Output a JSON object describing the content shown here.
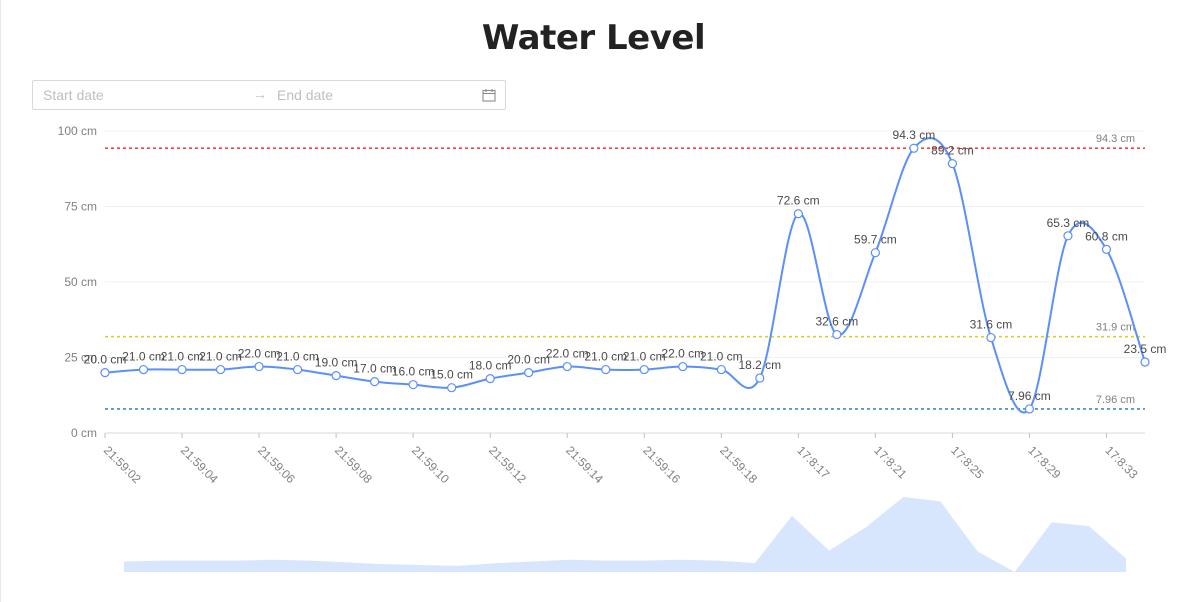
{
  "title": "Water Level",
  "range_picker": {
    "start_placeholder": "Start date",
    "end_placeholder": "End date",
    "separator": "→",
    "icon": "calendar-icon"
  },
  "colors": {
    "line": "#5b8ff9",
    "brush_fill": "#d8e6fd",
    "threshold_high": "#f04040",
    "threshold_mid": "#d4d426",
    "threshold_low": "#3a8ec6"
  },
  "chart_data": {
    "type": "line",
    "title": "Water Level",
    "unit": "cm",
    "ylim": [
      0,
      100
    ],
    "y_ticks": [
      "0 cm",
      "25 cm",
      "50 cm",
      "75 cm",
      "100 cm"
    ],
    "x_tick_labels": [
      "21:59:02",
      "21:59:04",
      "21:59:06",
      "21:59:08",
      "21:59:10",
      "21:59:12",
      "21:59:14",
      "21:59:16",
      "21:59:18",
      "17:8:17",
      "17:8:21",
      "17:8:25",
      "17:8:29",
      "17:8:33"
    ],
    "series": [
      {
        "values": [
          20.0,
          21.0,
          21.0,
          21.0,
          22.0,
          21.0,
          19.0,
          17.0,
          16.0,
          15.0,
          18.0,
          20.0,
          22.0,
          21.0,
          21.0,
          22.0,
          21.0,
          18.2,
          72.6,
          32.6,
          59.7,
          94.3,
          89.2,
          31.6,
          7.96,
          65.3,
          60.8,
          23.5
        ],
        "labels": [
          "20.0 cm",
          "21.0 cm",
          "21.0 cm",
          "21.0 cm",
          "22.0 cm",
          "21.0 cm",
          "19.0 cm",
          "17.0 cm",
          "16.0 cm",
          "15.0 cm",
          "18.0 cm",
          "20.0 cm",
          "22.0 cm",
          "21.0 cm",
          "21.0 cm",
          "22.0 cm",
          "21.0 cm",
          "18.2 cm",
          "72.6 cm",
          "32.6 cm",
          "59.7 cm",
          "94.3 cm",
          "89.2 cm",
          "31.6 cm",
          "7.96 cm",
          "65.3 cm",
          "60.8 cm",
          "23.5 cm"
        ]
      }
    ],
    "thresholds": [
      {
        "value": 94.3,
        "label": "94.3 cm",
        "color": "#f04040"
      },
      {
        "value": 31.9,
        "label": "31.9 cm",
        "color": "#d4d426"
      },
      {
        "value": 7.96,
        "label": "7.96 cm",
        "color": "#3a8ec6"
      }
    ],
    "grid": true,
    "brush": true
  }
}
